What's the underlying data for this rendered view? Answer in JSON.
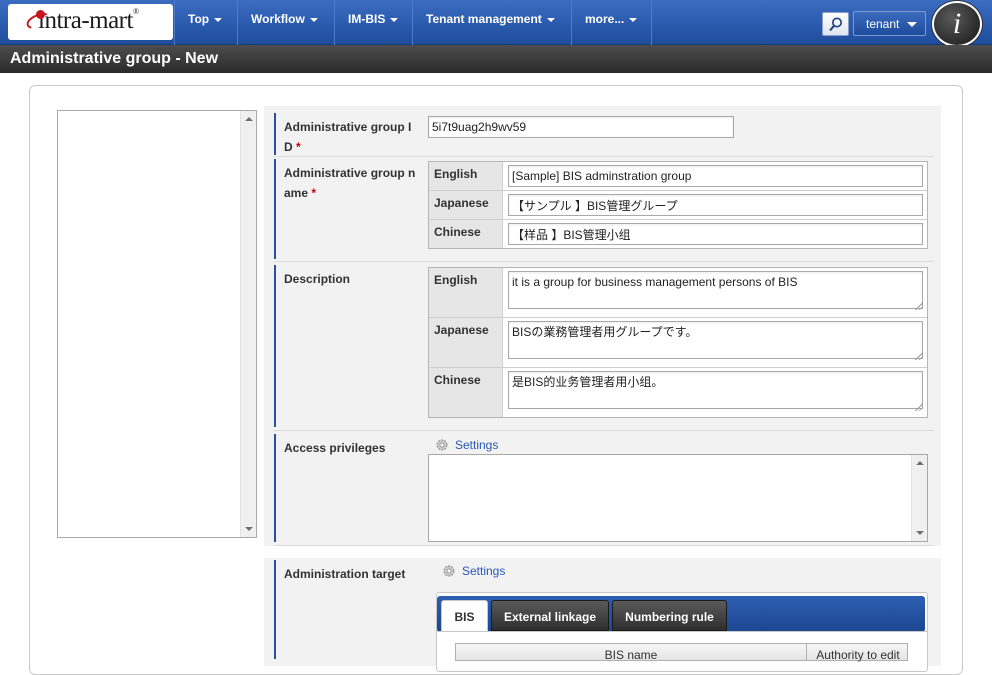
{
  "nav": {
    "logo_text": "intra-mart",
    "logo_mark": "®",
    "items": [
      {
        "label": "Top"
      },
      {
        "label": "Workflow"
      },
      {
        "label": "IM-BIS"
      },
      {
        "label": "Tenant management"
      },
      {
        "label": "more..."
      }
    ],
    "tenant_label": "tenant",
    "info_label": "i",
    "colors": {
      "bar": "#2a5bb0",
      "title_bar": "#333333",
      "required": "#cc0000",
      "link": "#2a57b8"
    }
  },
  "page": {
    "title": "Administrative group - New"
  },
  "form": {
    "group_id": {
      "label_line1": "Administrative group I",
      "label_line2": "D",
      "required": "*",
      "value": "5i7t9uag2h9wv59"
    },
    "group_name": {
      "label_line1": "Administrative group n",
      "label_line2": "ame",
      "required": "*",
      "rows": [
        {
          "lang": "English",
          "value": "[Sample] BIS adminstration group"
        },
        {
          "lang": "Japanese",
          "value": "【サンプル 】BIS管理グループ"
        },
        {
          "lang": "Chinese",
          "value": "【样品 】BIS管理小组"
        }
      ]
    },
    "description": {
      "label": "Description",
      "rows": [
        {
          "lang": "English",
          "value": "it is a group for business management persons of BIS"
        },
        {
          "lang": "Japanese",
          "value": "BISの業務管理者用グループです。"
        },
        {
          "lang": "Chinese",
          "value": "是BIS的业务管理者用小组。"
        }
      ]
    },
    "access": {
      "label": "Access privileges",
      "settings_label": "Settings",
      "icon": "gear-icon"
    },
    "target": {
      "label": "Administration target",
      "settings_label": "Settings",
      "icon": "gear-icon",
      "tabs": [
        {
          "label": "BIS",
          "active": true
        },
        {
          "label": "External linkage",
          "active": false
        },
        {
          "label": "Numbering rule",
          "active": false
        }
      ],
      "grid_headers": [
        "BIS name",
        "Authority to edit"
      ]
    }
  }
}
